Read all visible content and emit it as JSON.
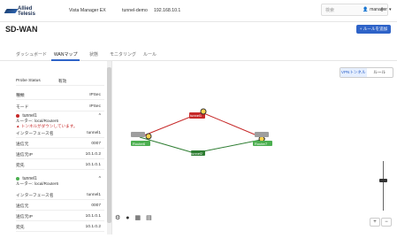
{
  "topbar": {
    "brand": "Allied Telesis",
    "product": "Vista Manager EX",
    "tenant": "tunnel-demo",
    "ip": "192.168.10.1",
    "search_placeholder": "検索",
    "user": "manager"
  },
  "page": {
    "title": "SD-WAN",
    "add_button": "+ ルールを追加"
  },
  "tabs": [
    {
      "label": "ダッシュボード"
    },
    {
      "label": "WANマップ"
    },
    {
      "label": "状態"
    },
    {
      "label": "モニタリング"
    },
    {
      "label": "ルール"
    }
  ],
  "panel": {
    "probe_status_label": "Probe Status",
    "probe_status_value": "有効",
    "type_label": "種類",
    "type_value": "IPSec",
    "mode_label": "モード",
    "mode_value": "IPSec",
    "tunnels": [
      {
        "name": "tunnel1",
        "router": "ルーター: local/Router6",
        "warning": "トンネルがダウンしています。",
        "iface_label": "インターフェース名",
        "iface_value": "tunnel1",
        "endpoint_label": "送信元",
        "endpoint_value": "0007",
        "ip_label": "送信元IP",
        "ip_value": "10.1.0.2",
        "dest_label": "宛先",
        "dest_value": "10.1.0.1"
      },
      {
        "name": "tunnel1",
        "router": "ルーター: local/Router6",
        "iface_label": "インターフェース名",
        "iface_value": "tunnel1",
        "endpoint_label": "送信元",
        "endpoint_value": "0007",
        "ip_label": "送信元IP",
        "ip_value": "10.1.0.1",
        "dest_label": "宛先",
        "dest_value": "10.1.0.2"
      }
    ]
  },
  "graph": {
    "toggle_left": "VPNトンネル",
    "toggle_right": "ルール",
    "nodes": [
      {
        "label": "Router6"
      },
      {
        "label": "Router7"
      }
    ],
    "link_labels": [
      {
        "label": "tunnel1",
        "color": "#c62828"
      },
      {
        "label": "tunnel2",
        "color": "#2e7d32"
      }
    ],
    "zoom_in": "+",
    "zoom_out": "−"
  },
  "colors": {
    "accent": "#2e63c8",
    "ok": "#4caf50",
    "down": "#c62828"
  }
}
